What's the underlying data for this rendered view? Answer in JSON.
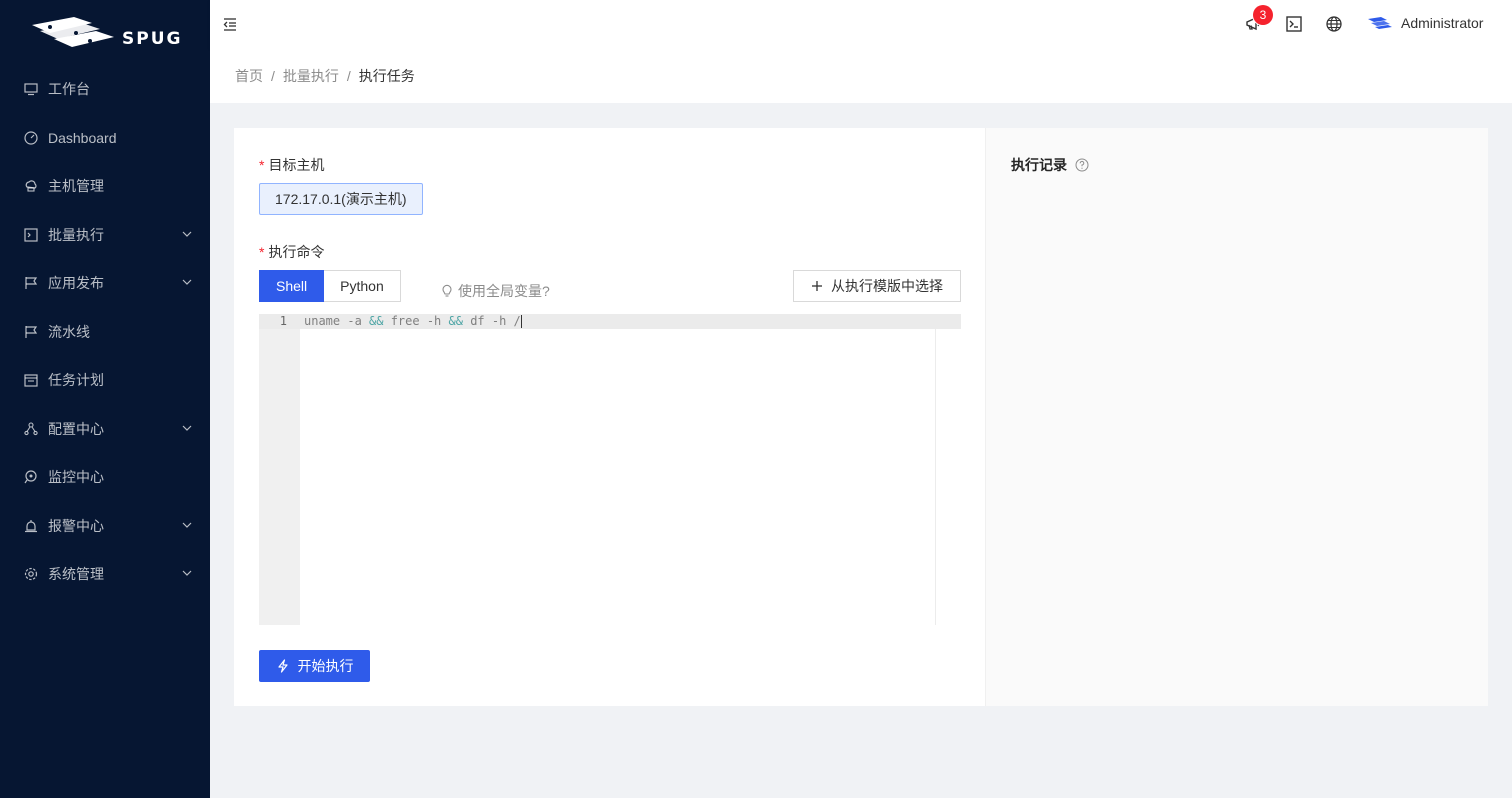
{
  "app": {
    "logo_text": "SPUG"
  },
  "sidebar": {
    "items": [
      {
        "label": "工作台",
        "icon": "desktop-icon",
        "expandable": false
      },
      {
        "label": "Dashboard",
        "icon": "dashboard-icon",
        "expandable": false
      },
      {
        "label": "主机管理",
        "icon": "cloud-server-icon",
        "expandable": false
      },
      {
        "label": "批量执行",
        "icon": "code-icon",
        "expandable": true
      },
      {
        "label": "应用发布",
        "icon": "flag-icon",
        "expandable": true
      },
      {
        "label": "流水线",
        "icon": "flag-icon",
        "expandable": false
      },
      {
        "label": "任务计划",
        "icon": "schedule-icon",
        "expandable": false
      },
      {
        "label": "配置中心",
        "icon": "deployment-unit-icon",
        "expandable": true
      },
      {
        "label": "监控中心",
        "icon": "radar-icon",
        "expandable": false
      },
      {
        "label": "报警中心",
        "icon": "alert-icon",
        "expandable": true
      },
      {
        "label": "系统管理",
        "icon": "setting-icon",
        "expandable": true
      }
    ]
  },
  "header": {
    "notification_count": "3",
    "user_name": "Administrator"
  },
  "breadcrumb": [
    "首页",
    "批量执行",
    "执行任务"
  ],
  "form": {
    "host_label": "目标主机",
    "host_value": "172.17.0.1(演示主机)",
    "command_label": "执行命令",
    "lang_tabs": [
      "Shell",
      "Python"
    ],
    "active_tab": "Shell",
    "global_var_hint": "使用全局变量?",
    "template_button": "从执行模版中选择",
    "run_button": "开始执行",
    "editor": {
      "line_number": "1",
      "code_parts": [
        "uname -a ",
        "&&",
        " free -h ",
        "&&",
        " df -h /"
      ]
    }
  },
  "records": {
    "title": "执行记录"
  },
  "colors": {
    "primary": "#2f5bea",
    "sidebar_bg": "#061632",
    "badge": "#f5222d"
  }
}
